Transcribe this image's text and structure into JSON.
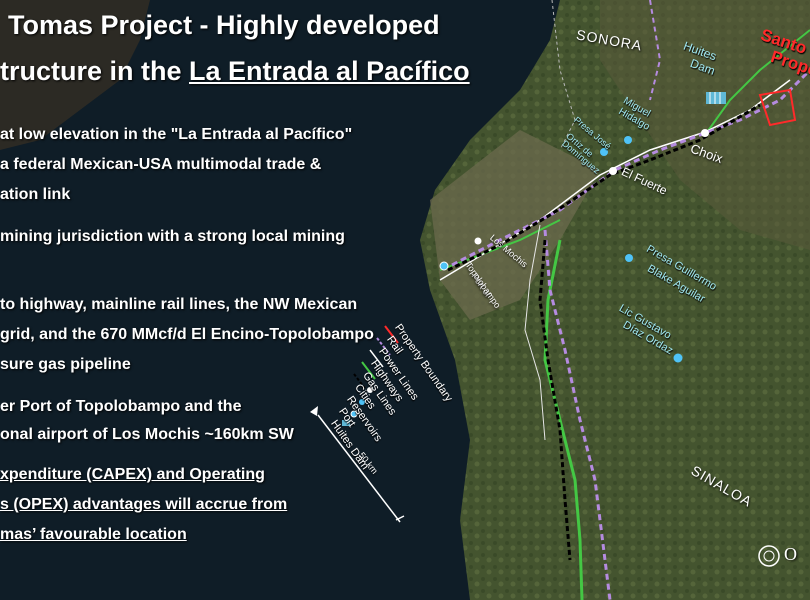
{
  "title": {
    "line1": "Tomas Project - Highly developed",
    "line2_prefix": "tructure in the ",
    "line2_link": "La Entrada al Pacífico"
  },
  "bullets": {
    "b1_l1_a": "at low elevation in the \"La Entrada al Pacífico\"",
    "b1_l2_a": "a federal Mexican-USA multimodal trade &",
    "b1_l3": "ation link",
    "b2_l1": "mining jurisdiction with a strong local mining",
    "b3_l1": "to highway, mainline rail lines, the NW Mexican",
    "b3_l2": "grid, and the 670 MMcf/d El Encino-Topolobampo",
    "b3_l3": "sure gas pipeline",
    "b4_l1": "er Port of Topolobampo and the",
    "b4_l2": "onal  airport of Los Mochis ~160km SW",
    "b5_l1": "xpenditure (CAPEX) and Operating",
    "b5_l2": "s (OPEX) advantages will accrue from",
    "b5_l3": "mas’ favourable location"
  },
  "map_labels": {
    "sonora": "SONORA",
    "sinaloa": "SINALOA",
    "huites_dam_l1": "Huites",
    "huites_dam_l2": "Dam",
    "santo_l1": "Santo",
    "santo_l2": "Prope",
    "miguel_l1": "Miguel",
    "miguel_l2": "Hidalgo",
    "presa_jose_l1": "Presa José",
    "presa_jose_l2": "Ortiz de",
    "presa_jose_l3": "Domínguez",
    "choix": "Choix",
    "el_fuerte": "El Fuerte",
    "los_mochis": "Los Mochis",
    "port_l1": "Port of",
    "port_l2": "Topolobampo",
    "presa_guillermo_l1": "Presa Guillermo",
    "presa_guillermo_l2": "Blake Aguilar",
    "lic_gustavo_l1": "Lic Gustavo",
    "lic_gustavo_l2": "Díaz Ordaz",
    "scale": "50 km",
    "logo": "O"
  },
  "legend": [
    "Property Boundary",
    "Rail",
    "Power Lines",
    "Highways",
    "Gas Lines",
    "Cities",
    "Reservoirs",
    "Port",
    "Huites Dam"
  ],
  "colors": {
    "sea": "#0f1e28",
    "land": "#4a5a35",
    "rail": "#b58be0",
    "power": "#ffffff",
    "highway": "#44c744",
    "gas": "#000000",
    "property": "#ff2a2a",
    "reservoir": "#4fc3f7"
  }
}
